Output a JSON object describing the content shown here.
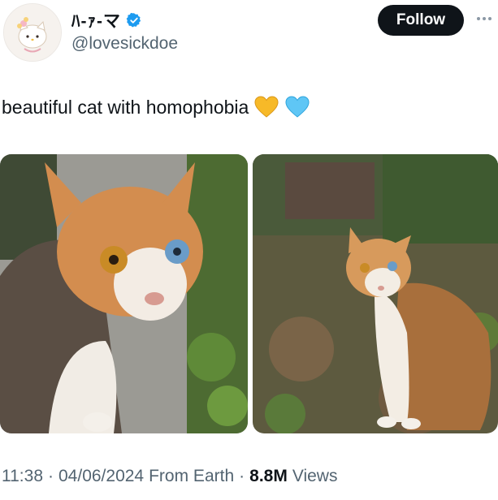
{
  "header": {
    "display_name": "ﾊ-ｧ-マ",
    "handle": "@lovesickdoe",
    "follow_label": "Follow",
    "avatar_icon": "hello-kitty-avatar",
    "verified_icon": "verified-badge-icon"
  },
  "tweet": {
    "text": "beautiful cat with homophobia",
    "emojis": [
      "yellow-heart",
      "light-blue-heart"
    ]
  },
  "media": {
    "images": [
      {
        "description_icon": "cat-photo-closeup"
      },
      {
        "description_icon": "cat-photo-standing"
      }
    ]
  },
  "meta": {
    "time": "11:38",
    "separator": "·",
    "date": "04/06/2024",
    "source": "From Earth",
    "views_count": "8.8M",
    "views_label": "Views"
  },
  "colors": {
    "text": "#0f1419",
    "secondary": "#536471",
    "verified": "#1d9bf0",
    "follow_bg": "#0f1419",
    "yellow_heart": "#f7b928",
    "blue_heart": "#5fc6f5"
  }
}
